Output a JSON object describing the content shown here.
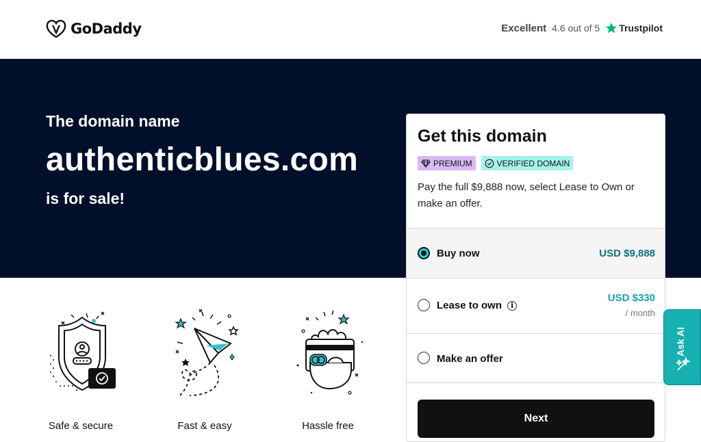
{
  "header": {
    "logo_text": "GoDaddy",
    "rating_label": "Excellent",
    "rating_score": "4.6 out of 5",
    "trustpilot": "Trustpilot"
  },
  "hero": {
    "intro": "The domain name",
    "domain": "authenticblues.com",
    "sale": "is for sale!"
  },
  "features": [
    {
      "label": "Safe & secure",
      "icon": "shield-icon"
    },
    {
      "label": "Fast & easy",
      "icon": "paper-plane-icon"
    },
    {
      "label": "Hassle free",
      "icon": "hand-card-icon"
    }
  ],
  "card": {
    "title": "Get this domain",
    "badge_premium": "PREMIUM",
    "badge_verified": "VERIFIED DOMAIN",
    "description": "Pay the full $9,888 now, select Lease to Own or make an offer.",
    "options": [
      {
        "label": "Buy now",
        "price": "USD $9,888",
        "selected": true
      },
      {
        "label": "Lease to own",
        "price": "USD $330",
        "unit": "/ month",
        "selected": false
      },
      {
        "label": "Make an offer",
        "selected": false
      }
    ],
    "next": "Next"
  },
  "ask_ai": "Ask AI",
  "colors": {
    "hero_bg": "#000f2a",
    "accent_teal": "#17b0b0",
    "premium_badge": "#d9b8f5",
    "verified_badge": "#a5f3e9"
  }
}
